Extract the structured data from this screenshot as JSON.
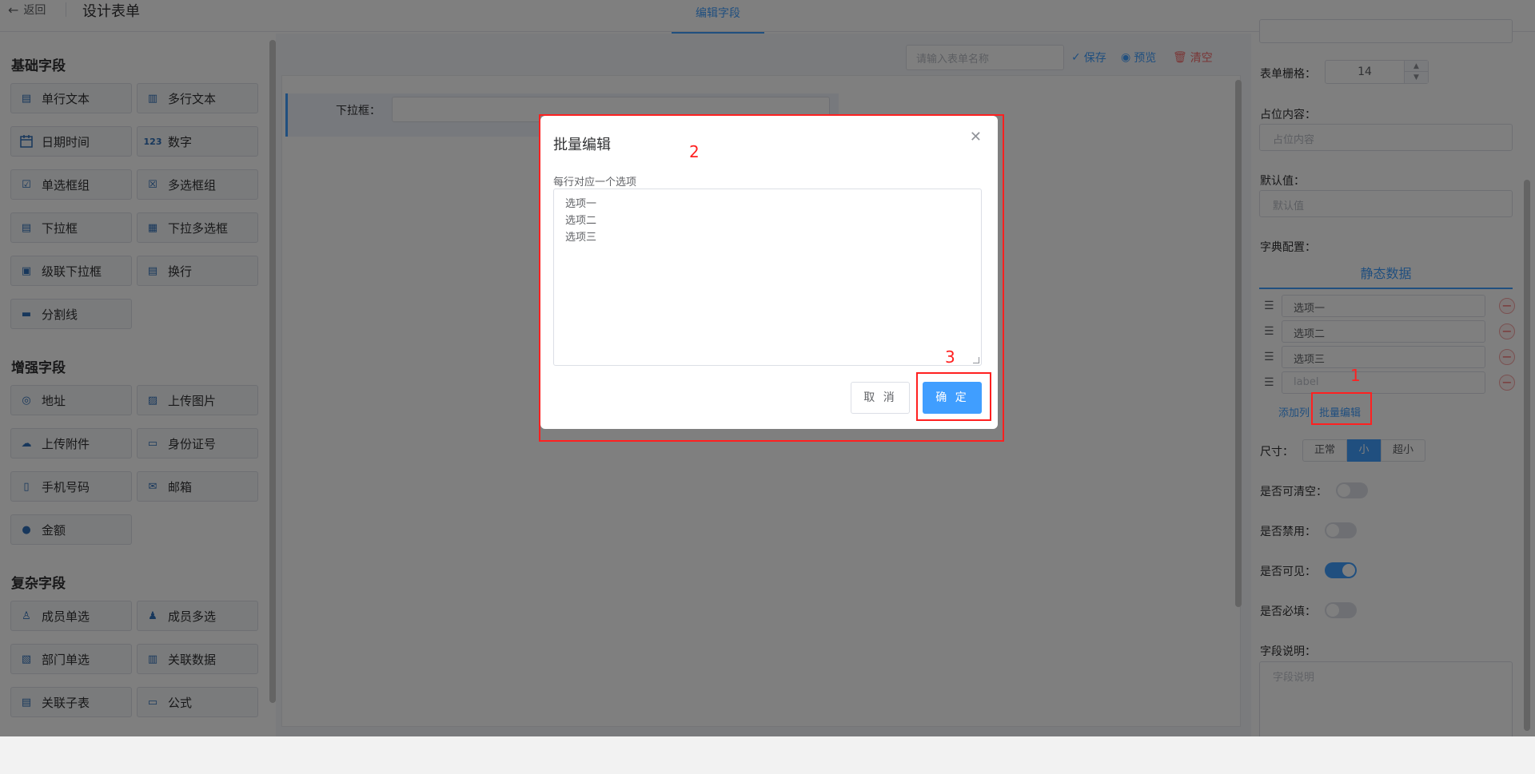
{
  "header": {
    "back_label": "返回",
    "title": "设计表单",
    "center_tab": "编辑字段"
  },
  "left_panel": {
    "sections": {
      "basic": "基础字段",
      "enhanced": "增强字段",
      "complex": "复杂字段"
    },
    "basic_fields": [
      "单行文本",
      "多行文本",
      "日期时间",
      "数字",
      "单选框组",
      "多选框组",
      "下拉框",
      "下拉多选框",
      "级联下拉框",
      "换行",
      "分割线"
    ],
    "enhanced_fields": [
      "地址",
      "上传图片",
      "上传附件",
      "身份证号",
      "手机号码",
      "邮箱",
      "金额"
    ],
    "complex_fields": [
      "成员单选",
      "成员多选",
      "部门单选",
      "关联数据",
      "关联子表",
      "公式"
    ]
  },
  "toolbar": {
    "form_name_placeholder": "请输入表单名称",
    "save_label": "保存",
    "preview_label": "预览",
    "clear_label": "清空"
  },
  "canvas": {
    "field_label": "下拉框："
  },
  "right_panel": {
    "grid_label": "表单栅格：",
    "grid_value": "14",
    "placeholder_label": "占位内容：",
    "placeholder_input": "占位内容",
    "default_label": "默认值：",
    "default_input": "默认值",
    "dict_label": "字典配置：",
    "static_tab": "静态数据",
    "options": [
      "选项一",
      "选项二",
      "选项三"
    ],
    "new_option_placeholder": "label",
    "add_column": "添加列",
    "batch_edit": "批量编辑",
    "size_label": "尺寸：",
    "sizes": [
      "正常",
      "小",
      "超小"
    ],
    "clearable_label": "是否可清空：",
    "disabled_label": "是否禁用：",
    "visible_label": "是否可见：",
    "required_label": "是否必填：",
    "desc_label": "字段说明：",
    "desc_placeholder": "字段说明"
  },
  "dialog": {
    "title": "批量编辑",
    "hint": "每行对应一个选项",
    "lines": [
      "选项一",
      "选项二",
      "选项三"
    ],
    "cancel": "取 消",
    "confirm": "确 定"
  },
  "annotations": [
    "1",
    "2",
    "3"
  ],
  "colors": {
    "primary": "#409eff",
    "danger": "#f56c6c",
    "annotation": "#ff2020"
  }
}
